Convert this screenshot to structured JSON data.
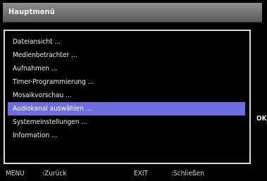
{
  "title": "Hauptmenü",
  "menu_items": [
    "Dateiansicht ...",
    "Medienbetrachter ...",
    "Aufnahmen ...",
    "Timer-Programmierung ...",
    "Mosaikvorschau ...",
    "Audiokanal auswählen ...",
    "Systemeinstellungen ...",
    "Information ..."
  ],
  "selected_item": "Audiokanal auswählen ...",
  "side_hint": "OK",
  "footer": {
    "menu_key": "MENU",
    "menu_action": ":Zurück",
    "exit_key": "EXIT",
    "exit_action": ":Schließen"
  },
  "colors": {
    "selection": "#6d6de0",
    "title_bar": "#7a7a7a",
    "background": "#000000"
  }
}
